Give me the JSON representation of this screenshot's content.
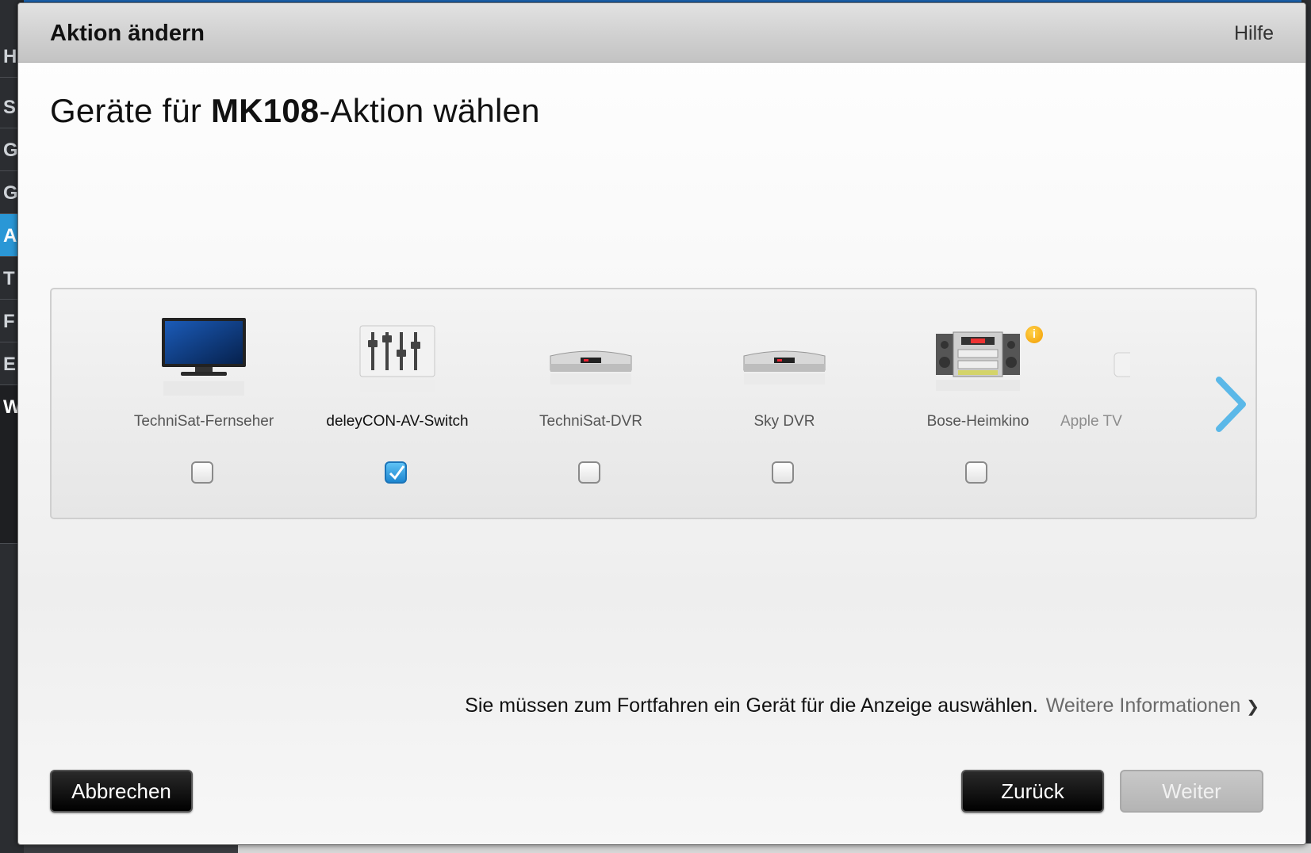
{
  "background": {
    "sidebar_letters": [
      "Ha",
      "S",
      "G",
      "G",
      "A",
      "T",
      "F",
      "E",
      "W"
    ]
  },
  "dialog": {
    "title": "Aktion ändern",
    "help": "Hilfe",
    "heading_prefix": "Geräte für ",
    "heading_bold": "MK108",
    "heading_suffix": "-Aktion wählen",
    "devices": [
      {
        "name": "TechniSat-Fernseher",
        "icon": "tv-icon",
        "checked": false
      },
      {
        "name": "deleyCON-AV-Switch",
        "icon": "av-switch-icon",
        "checked": true
      },
      {
        "name": "TechniSat-DVR",
        "icon": "dvr-icon",
        "checked": false
      },
      {
        "name": "Sky DVR",
        "icon": "dvr-icon",
        "checked": false
      },
      {
        "name": "Bose-Heimkino",
        "icon": "home-theater-icon",
        "checked": false,
        "info_badge": "i"
      },
      {
        "name": "Apple TV",
        "icon": "apple-tv-icon",
        "partial": true
      }
    ],
    "notice": "Sie müssen zum Fortfahren ein Gerät für die Anzeige auswählen.",
    "more_info": "Weitere Informationen",
    "buttons": {
      "cancel": "Abbrechen",
      "back": "Zurück",
      "next": "Weiter"
    }
  },
  "colors": {
    "accent_blue": "#1d86d0",
    "arrow_blue": "#5bb8e8"
  }
}
